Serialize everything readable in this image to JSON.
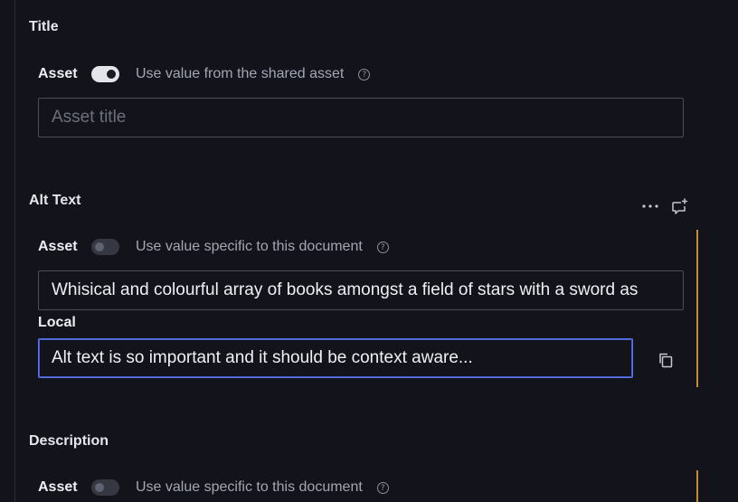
{
  "title_section": {
    "heading": "Title",
    "asset_label": "Asset",
    "toggle_on": true,
    "toggle_desc": "Use value from the shared asset",
    "help_glyph": "?",
    "field_placeholder": "Asset title",
    "field_value": ""
  },
  "alt_text_section": {
    "heading": "Alt Text",
    "menu_icon": "more-horizontal-icon",
    "comment_icon": "add-comment-icon",
    "asset_label": "Asset",
    "toggle_on": false,
    "toggle_desc": "Use value specific to this document",
    "help_glyph": "?",
    "asset_field_value": "Whisical and colourful array of books amongst a field of stars with a sword as",
    "local_label": "Local",
    "local_field_value": "Alt text is so important and it should be context aware...",
    "copy_icon": "copy-icon"
  },
  "description_section": {
    "heading": "Description",
    "asset_label": "Asset",
    "toggle_on": false,
    "toggle_desc": "Use value specific to this document",
    "help_glyph": "?"
  },
  "colors": {
    "background": "#13141b",
    "accent_focus": "#5b73e8",
    "change_indicator": "#c28a3a"
  }
}
